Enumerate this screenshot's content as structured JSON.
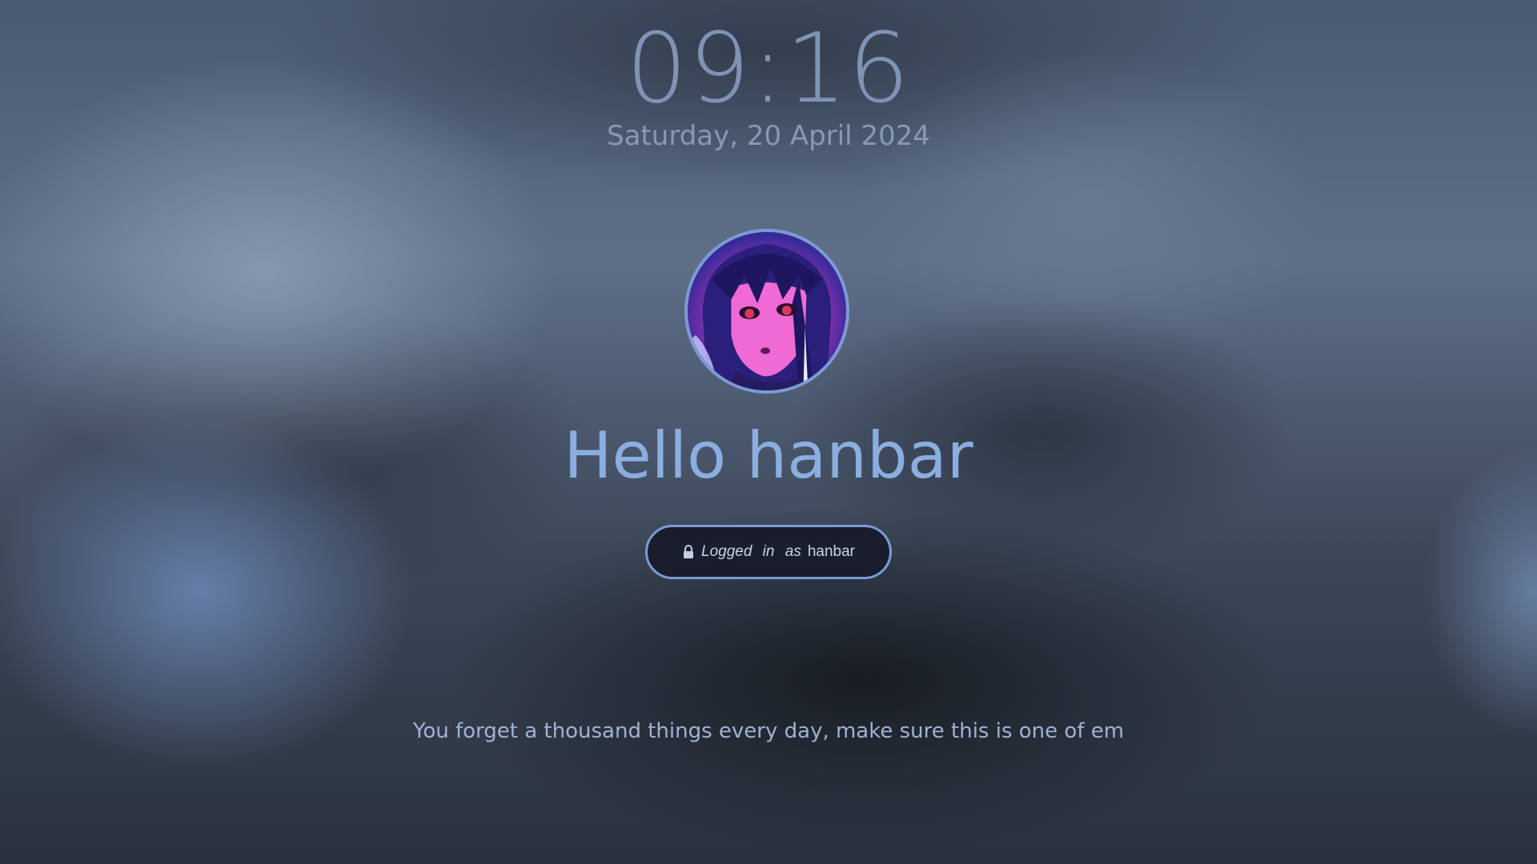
{
  "lockscreen": {
    "time": "09:16",
    "date": "Saturday, 20 April 2024",
    "greeting": "Hello hanbar",
    "login_status": {
      "icon": "lock-icon",
      "label": "Logged in as",
      "username": "hanbar"
    },
    "quote": "You forget a thousand things every day, make sure this is one of em"
  },
  "colors": {
    "accent": "#7b9bd6",
    "clock": "#7f93b5",
    "greeting": "#8aaee0",
    "pill_background": "#1a1e2c"
  }
}
